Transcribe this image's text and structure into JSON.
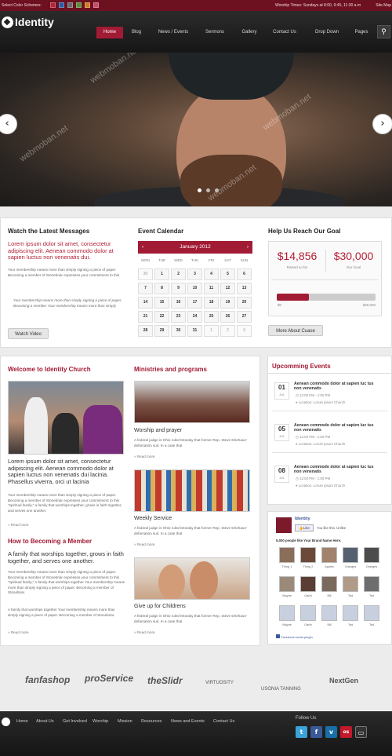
{
  "topbar": {
    "schemes_label": "Select Color Schemes:",
    "scheme_colors": [
      "#b3243b",
      "#2b5aa7",
      "#6a6a6a",
      "#5b8d3a",
      "#d27a22",
      "#c44d6a"
    ],
    "worship": "Worship Times: Sundays at 8:00, 9:45, 11:30 a.m",
    "sitemap": "Site Map"
  },
  "header": {
    "logo": "Identity",
    "nav": [
      "Home",
      "Blog",
      "News / Events",
      "Sermons",
      "Gallery",
      "Contact Us",
      "Drop Down",
      "Pages"
    ],
    "active_nav": "Home"
  },
  "hero": {
    "watermark": "webmoban.net",
    "slides": 3,
    "current_slide": 1
  },
  "messages": {
    "title": "Watch the Latest Messages",
    "lead": "Lorem ipsum dolor sit amet, consectetur adipiscing elit. Aenean commodo dolor at sapien luctus non venenatis dui.",
    "body": "Your membership means more than simply signing a piece of paper. Becoming a member of Stonebriar expresses your commitment to this",
    "quote": "Your membership means more than simply signing a piece of paper. Becoming a member Your membership means more than simply",
    "button": "Watch Video"
  },
  "calendar": {
    "title": "Event Calendar",
    "month": "January 2012",
    "days": [
      "MON",
      "TUE",
      "WED",
      "THU",
      "FRI",
      "SAT",
      "SUN"
    ],
    "cells": [
      "30",
      "1",
      "2",
      "3",
      "4",
      "5",
      "6",
      "7",
      "8",
      "9",
      "10",
      "11",
      "12",
      "13",
      "14",
      "15",
      "16",
      "17",
      "18",
      "19",
      "20",
      "21",
      "22",
      "23",
      "24",
      "25",
      "26",
      "27",
      "28",
      "29",
      "30",
      "31",
      "1",
      "2",
      "3"
    ]
  },
  "goal": {
    "title": "Help Us Reach Our Goal",
    "raised": "$14,856",
    "raised_label": "Raised so far",
    "goal": "$30,000",
    "goal_label": "Our Goal",
    "progress": 0.495,
    "min_label": "$0",
    "max_label": "$30,000",
    "button": "More About Cuase"
  },
  "welcome": {
    "title": "Welcome to Identity Church",
    "lead": "Lorem ipsum dolor sit amet, consectetur adipiscing elit. Aenean commodo dolor at sapien luctus non venenatis dui lacinia. Phasellus viverra, orci ut lacinia",
    "body": "Your membership means more than simply signing a piece of paper. Becoming a member of Stonebriar expresses your commitment to this \"spiritual family,\" a family that worships together, grows in faith together, and serves one another.",
    "read_more": "Read more",
    "how_title": "How to Becoming a Member",
    "how_lead": "A family that worships together, grows in faith together, and serves one another.",
    "how_body": "Your membership means more than simply signing a piece of paper. Becoming a member of Stonebriar expresses your commitment to this \"spiritual family,\" A family that worships together Your membership means more than simply signing a piece of paper. Becoming a member of Stonebriar.",
    "how_body2": "A family that worships together Your membership means more than simply signing a piece of paper. Becoming a member of Stonebriar.",
    "read_more2": "Read more"
  },
  "ministries": {
    "title": "Ministries and programs",
    "items": [
      {
        "caption": "Worship and prayer",
        "text": "A federal judge in Ohio ruled Monday that former Rep. Steve Driehaus' defamation suit. In a case that",
        "more": "Read more"
      },
      {
        "caption": "Weekly Service",
        "text": "A federal judge in Ohio ruled Monday that former Rep. Steve Driehaus' defamation suit. In a case that",
        "more": "Read more"
      },
      {
        "caption": "Give up for Childrens",
        "text": "A federal judge in Ohio ruled Monday that former Rep. Steve Driehaus' defamation suit. In a case that",
        "more": "Read more"
      }
    ]
  },
  "events": {
    "title": "Upcomming Events",
    "items": [
      {
        "day": "01",
        "month": "JUL",
        "title": "Aenean commodo dolor at sapien luc tus non venenatis",
        "time": "12:00 PM - 1:00 PM",
        "location": "Location: Loruin ipsum Church"
      },
      {
        "day": "05",
        "month": "JUL",
        "title": "Aenean commodo dolor at sapien luc tus non venenatis",
        "time": "12:00 PM - 1:00 PM",
        "location": "Location: Loruin ipsum Church"
      },
      {
        "day": "08",
        "month": "JUL",
        "title": "Aenean commodo dolor at sapien luc tus non venenatis",
        "time": "12:00 PM - 1:00 PM",
        "location": "Location: Loruin ipsum Church"
      }
    ]
  },
  "facebook": {
    "page_name": "Identity",
    "like_btn": "Like",
    "like_text": "You like this. Unlike",
    "people_text": "5,000 people like Your Brand Name Here.",
    "names": [
      "Thing 1",
      "Thing 2",
      "Apples",
      "Oranges",
      "Oranges",
      "Wayne",
      "Garth",
      "Bill",
      "Ted",
      "Ted",
      "Wayne",
      "Garth",
      "Bill",
      "Ted",
      "Ted"
    ],
    "plugin": "Facebook social plugin"
  },
  "sponsors": [
    "fanfashop",
    "proService",
    "theSlidr",
    "VIRTUOSITY",
    "USONIA TANNING",
    "NextGen"
  ],
  "footer": {
    "links": [
      "Home",
      "About Us",
      "Get Involved",
      "Worship",
      "Mission",
      "Resources",
      "News and Events",
      "Contact Us"
    ],
    "follow": "Follow Us",
    "social": [
      "t",
      "f",
      "v",
      "ts",
      "rss"
    ]
  }
}
